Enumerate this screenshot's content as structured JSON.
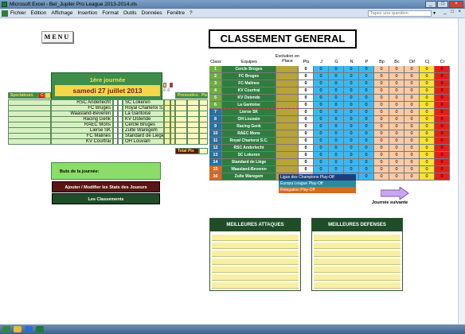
{
  "window": {
    "title": "Microsoft Excel - Bel_Jupiler Pro League 2013-2014.xls"
  },
  "menu": {
    "items": [
      "Fichier",
      "Edition",
      "Affichage",
      "Insertion",
      "Format",
      "Outils",
      "Données",
      "Fenêtre",
      "?"
    ],
    "help_placeholder": "Tapez une question"
  },
  "sheet": {
    "menu_button": "MENU",
    "title": "CLASSEMENT GENERAL",
    "journee": {
      "label": "1ère journée",
      "date": "samedi 27 juillet 2013"
    },
    "match_headers": {
      "spectateurs": "Spectateurs",
      "cr": "Cr",
      "pronostics": "Pronostics",
      "pts": "Pts"
    },
    "home_teams": [
      "RSC Anderlecht",
      "FC Bruges",
      "Waasland-Beveren",
      "Racing Genk",
      "RAEC Mons",
      "Lierse SK",
      "FC Malines",
      "KV Courtrai"
    ],
    "away_teams": [
      "SC Lokeren",
      "Royal Charleroi S.C.",
      "La Gantoise",
      "KV Ostende",
      "Cercle Bruges",
      "Zulte Waregem",
      "Standard de Liège",
      "OH Louvain"
    ],
    "total_label": "Total Pts",
    "buts_label": "Buts de la journée:",
    "btn_stats": "Ajouter / Modifier les Stats des Joueurs",
    "btn_classements": "Les Classements",
    "next_label": "Journée suivante",
    "best_attack": "MEILLEURES ATTAQUES",
    "best_defense": "MEILLEURES DEFENSES"
  },
  "ranking": {
    "headers": {
      "class": "Class",
      "equipes": "Equipes",
      "evolution": "Evolution en Place",
      "pts": "Pts",
      "j": "J",
      "g": "G",
      "n": "N",
      "p": "P",
      "bp": "Bp",
      "bc": "Bc",
      "dif": "Dif",
      "cj": "Cj",
      "cr": "Cr"
    },
    "rows": [
      {
        "pos": "1",
        "team": "Cercle Bruges",
        "color": "#6fae43"
      },
      {
        "pos": "2",
        "team": "FC Bruges",
        "color": "#6fae43"
      },
      {
        "pos": "3",
        "team": "FC Malines",
        "color": "#6fae43"
      },
      {
        "pos": "4",
        "team": "KV Courtrai",
        "color": "#6fae43"
      },
      {
        "pos": "5",
        "team": "KV Ostende",
        "color": "#6fae43"
      },
      {
        "pos": "6",
        "team": "La Gantoise",
        "color": "#6fae43"
      },
      {
        "pos": "7",
        "team": "Lierse SK",
        "color": "#2a6f9e"
      },
      {
        "pos": "8",
        "team": "OH Louvain",
        "color": "#2a6f9e"
      },
      {
        "pos": "9",
        "team": "Racing Genk",
        "color": "#2a6f9e"
      },
      {
        "pos": "10",
        "team": "RAEC Mons",
        "color": "#2a6f9e"
      },
      {
        "pos": "11",
        "team": "Royal Charleroi S.C.",
        "color": "#2a6f9e"
      },
      {
        "pos": "12",
        "team": "RSC Anderlecht",
        "color": "#2a6f9e"
      },
      {
        "pos": "13",
        "team": "SC Lokeren",
        "color": "#2a6f9e"
      },
      {
        "pos": "14",
        "team": "Standard de Liège",
        "color": "#2a6f9e"
      },
      {
        "pos": "15",
        "team": "Waasland-Beveren",
        "color": "#d8691f"
      },
      {
        "pos": "16",
        "team": "Zulte Waregem",
        "color": "#d8691f"
      }
    ],
    "zero": "0"
  },
  "legend": [
    {
      "label": "Ligue des Champions Play-Off",
      "color": "#1e3f7a"
    },
    {
      "label": "Europa League Play-Off",
      "color": "#2a8a9e"
    },
    {
      "label": "Relegation Play-Off",
      "color": "#d8691f"
    }
  ]
}
